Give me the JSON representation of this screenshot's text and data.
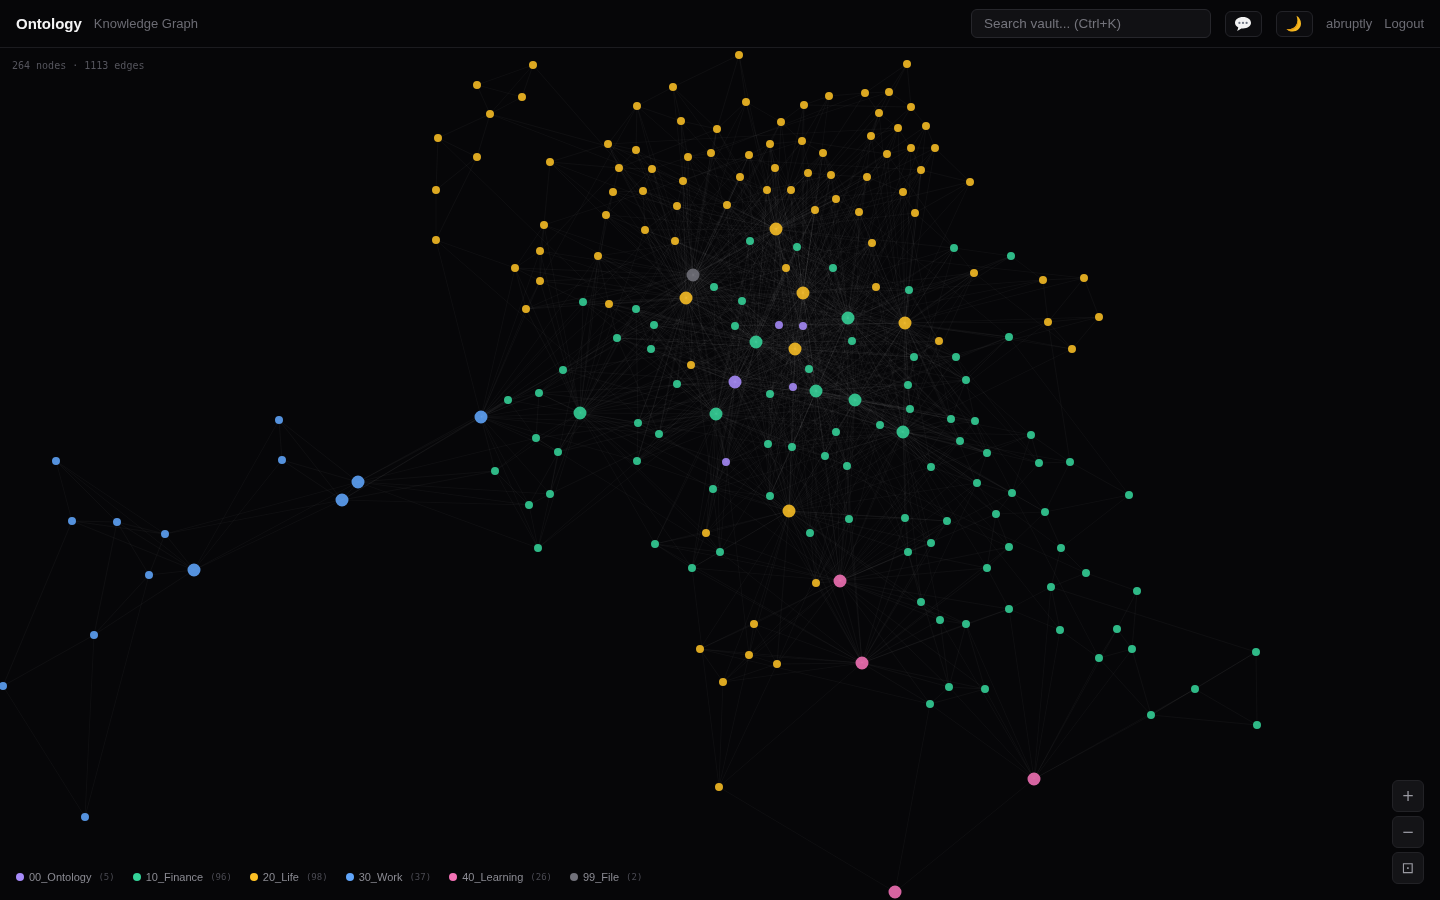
{
  "header": {
    "title": "Ontology",
    "subtitle": "Knowledge Graph",
    "search": {
      "placeholder": "Search vault... (Ctrl+K)"
    },
    "user": "abruptly",
    "logout": "Logout"
  },
  "stats": "264 nodes · 1113 edges",
  "legend": [
    {
      "name": "00_Ontology",
      "count": "(5)",
      "color": "#a78bfa"
    },
    {
      "name": "10_Finance",
      "count": "(96)",
      "color": "#34d399"
    },
    {
      "name": "20_Life",
      "count": "(98)",
      "color": "#fbbf24"
    },
    {
      "name": "30_Work",
      "count": "(37)",
      "color": "#60a5fa"
    },
    {
      "name": "40_Learning",
      "count": "(26)",
      "color": "#f472b6"
    },
    {
      "name": "99_File",
      "count": "(2)",
      "color": "#71717a"
    }
  ],
  "zoom_controls": [
    "+",
    "−",
    "⊡"
  ]
}
